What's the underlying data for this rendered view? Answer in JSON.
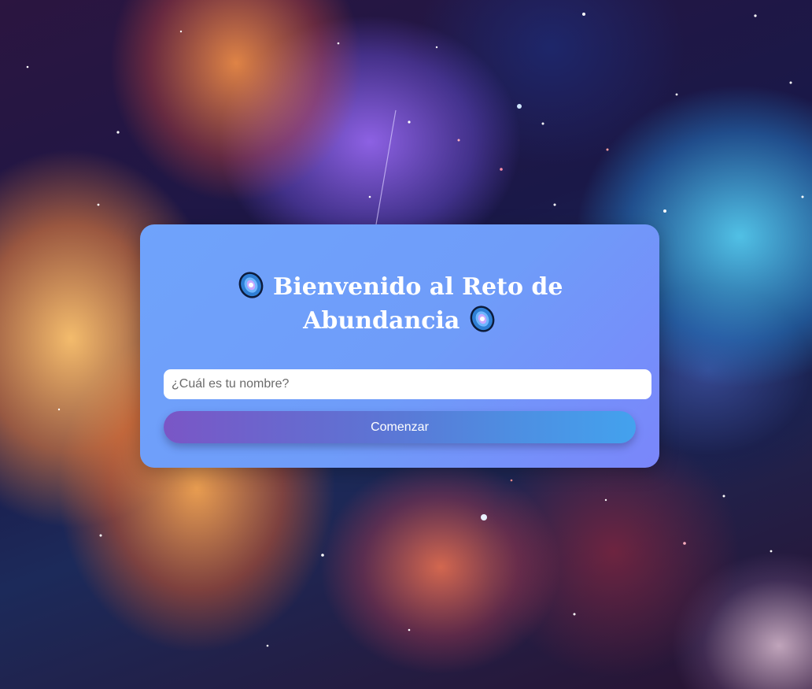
{
  "welcome": {
    "title_line_1": "Bienvenido al Reto de",
    "title_line_2": "Abundancia",
    "decor_icon": "galaxy-icon",
    "name_placeholder": "¿Cuál es tu nombre?",
    "start_label": "Comenzar"
  },
  "colors": {
    "card": "#6fa3fb",
    "button_start": "#7a56c6",
    "button_end": "#43a2ee",
    "text": "#ffffff"
  }
}
